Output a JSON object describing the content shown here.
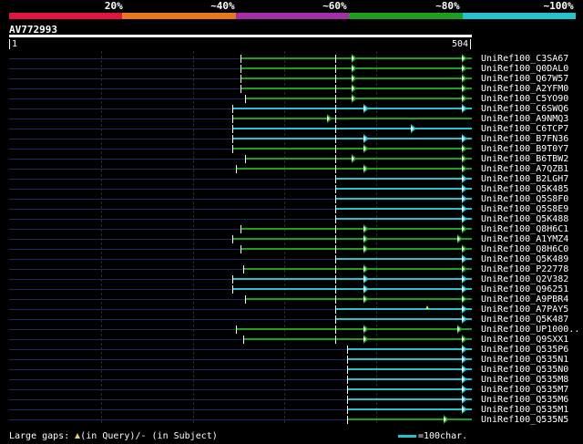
{
  "legend": {
    "labels": [
      "20%",
      "~40%",
      "~60%",
      "~80%",
      "~100%"
    ],
    "colors": [
      "#e0143c",
      "#e8781e",
      "#a42ea8",
      "#1e9e1e",
      "#23c2cc"
    ]
  },
  "query": {
    "id": "AV772993",
    "start": "1",
    "end": "504",
    "length": 504
  },
  "colors": {
    "green": "#1e9e1e",
    "cyan": "#23c2cc",
    "dark_line": "#1c2a60",
    "insert_marker": "#e8d070"
  },
  "hits": [
    {
      "id": "UniRef100_C3SA67",
      "start": 252,
      "color": "green",
      "ticks": [
        355
      ],
      "gaps": [
        375,
        495
      ]
    },
    {
      "id": "UniRef100_Q0DAL0",
      "start": 252,
      "color": "green",
      "ticks": [
        355
      ],
      "gaps": [
        375,
        495
      ]
    },
    {
      "id": "UniRef100_Q67W57",
      "start": 252,
      "color": "green",
      "ticks": [
        355
      ],
      "gaps": [
        375,
        495
      ]
    },
    {
      "id": "UniRef100_A2YFM0",
      "start": 252,
      "color": "green",
      "ticks": [
        355
      ],
      "gaps": [
        375,
        495
      ]
    },
    {
      "id": "UniRef100_C5YO90",
      "start": 257,
      "color": "green",
      "ticks": [
        355
      ],
      "gaps": [
        375,
        495
      ]
    },
    {
      "id": "UniRef100_C6SWQ6",
      "start": 243,
      "color": "cyan",
      "ticks": [
        355
      ],
      "gaps": [
        388,
        495
      ]
    },
    {
      "id": "UniRef100_A9NMQ3",
      "start": 243,
      "color": "green",
      "ticks": [
        355
      ],
      "gaps": [
        348
      ]
    },
    {
      "id": "UniRef100_C6TCP7",
      "start": 243,
      "color": "cyan",
      "ticks": [
        355
      ],
      "gaps": [
        440
      ]
    },
    {
      "id": "UniRef100_B7FN36",
      "start": 243,
      "color": "cyan",
      "ticks": [
        355
      ],
      "gaps": [
        388,
        495
      ]
    },
    {
      "id": "UniRef100_B9T0Y7",
      "start": 243,
      "color": "green",
      "ticks": [
        355
      ],
      "gaps": [
        388,
        495
      ]
    },
    {
      "id": "UniRef100_B6TBW2",
      "start": 257,
      "color": "green",
      "ticks": [
        355
      ],
      "gaps": [
        375,
        495
      ]
    },
    {
      "id": "UniRef100_A7QZB1",
      "start": 247,
      "color": "green",
      "ticks": [
        355
      ],
      "gaps": [
        388,
        495
      ]
    },
    {
      "id": "UniRef100_B2LGH7",
      "start": 355,
      "color": "cyan",
      "ticks": [],
      "gaps": [
        495
      ]
    },
    {
      "id": "UniRef100_Q5K485",
      "start": 355,
      "color": "cyan",
      "ticks": [],
      "gaps": [
        495
      ]
    },
    {
      "id": "UniRef100_Q5S8F0",
      "start": 355,
      "color": "cyan",
      "ticks": [],
      "gaps": [
        495
      ]
    },
    {
      "id": "UniRef100_Q5S8E9",
      "start": 355,
      "color": "cyan",
      "ticks": [],
      "gaps": [
        495
      ]
    },
    {
      "id": "UniRef100_Q5K488",
      "start": 355,
      "color": "cyan",
      "ticks": [],
      "gaps": [
        495
      ]
    },
    {
      "id": "UniRef100_Q8H6C1",
      "start": 252,
      "color": "green",
      "ticks": [
        355
      ],
      "gaps": [
        388,
        495
      ]
    },
    {
      "id": "UniRef100_A1YMZ4",
      "start": 243,
      "color": "green",
      "ticks": [
        355
      ],
      "gaps": [
        388,
        490
      ]
    },
    {
      "id": "UniRef100_Q8H6C0",
      "start": 252,
      "color": "green",
      "ticks": [
        355
      ],
      "gaps": [
        388,
        495
      ]
    },
    {
      "id": "UniRef100_Q5K489",
      "start": 355,
      "color": "cyan",
      "ticks": [],
      "gaps": [
        495
      ]
    },
    {
      "id": "UniRef100_P22778",
      "start": 255,
      "color": "green",
      "ticks": [
        355
      ],
      "gaps": [
        388,
        495
      ]
    },
    {
      "id": "UniRef100_Q2V382",
      "start": 243,
      "color": "cyan",
      "ticks": [
        355
      ],
      "gaps": [
        388,
        495
      ]
    },
    {
      "id": "UniRef100_Q96251",
      "start": 243,
      "color": "cyan",
      "ticks": [
        355
      ],
      "gaps": [
        388,
        495
      ]
    },
    {
      "id": "UniRef100_A9PBR4",
      "start": 257,
      "color": "green",
      "ticks": [
        355
      ],
      "gaps": [
        388,
        495
      ]
    },
    {
      "id": "UniRef100_A7PAY5",
      "start": 355,
      "color": "cyan",
      "ticks": [],
      "gaps": [
        495
      ],
      "insert": 455
    },
    {
      "id": "UniRef100_Q5K487",
      "start": 355,
      "color": "cyan",
      "ticks": [],
      "gaps": [
        495
      ]
    },
    {
      "id": "UniRef100_UP1000..",
      "start": 247,
      "color": "green",
      "ticks": [
        355
      ],
      "gaps": [
        388,
        490
      ]
    },
    {
      "id": "UniRef100_Q9SXX1",
      "start": 255,
      "color": "green",
      "ticks": [
        355
      ],
      "gaps": [
        388,
        495
      ]
    },
    {
      "id": "UniRef100_Q535P6",
      "start": 368,
      "color": "cyan",
      "ticks": [],
      "gaps": [
        495
      ]
    },
    {
      "id": "UniRef100_Q535N1",
      "start": 368,
      "color": "cyan",
      "ticks": [],
      "gaps": [
        495
      ]
    },
    {
      "id": "UniRef100_Q535N0",
      "start": 368,
      "color": "cyan",
      "ticks": [],
      "gaps": [
        495
      ]
    },
    {
      "id": "UniRef100_Q535M8",
      "start": 368,
      "color": "cyan",
      "ticks": [],
      "gaps": [
        495
      ]
    },
    {
      "id": "UniRef100_Q535M7",
      "start": 368,
      "color": "cyan",
      "ticks": [],
      "gaps": [
        495
      ]
    },
    {
      "id": "UniRef100_Q535M6",
      "start": 368,
      "color": "cyan",
      "ticks": [],
      "gaps": [
        495
      ]
    },
    {
      "id": "UniRef100_Q535M1",
      "start": 368,
      "color": "cyan",
      "ticks": [],
      "gaps": [
        495
      ]
    },
    {
      "id": "UniRef100_Q535N5",
      "start": 368,
      "color": "green",
      "ticks": [],
      "gaps": [
        475
      ]
    }
  ],
  "footer": {
    "large_gaps_prefix": "Large gaps: ",
    "in_query": "(in Query)",
    "in_subject": "/- (in Subject)",
    "scale": "=100char."
  }
}
